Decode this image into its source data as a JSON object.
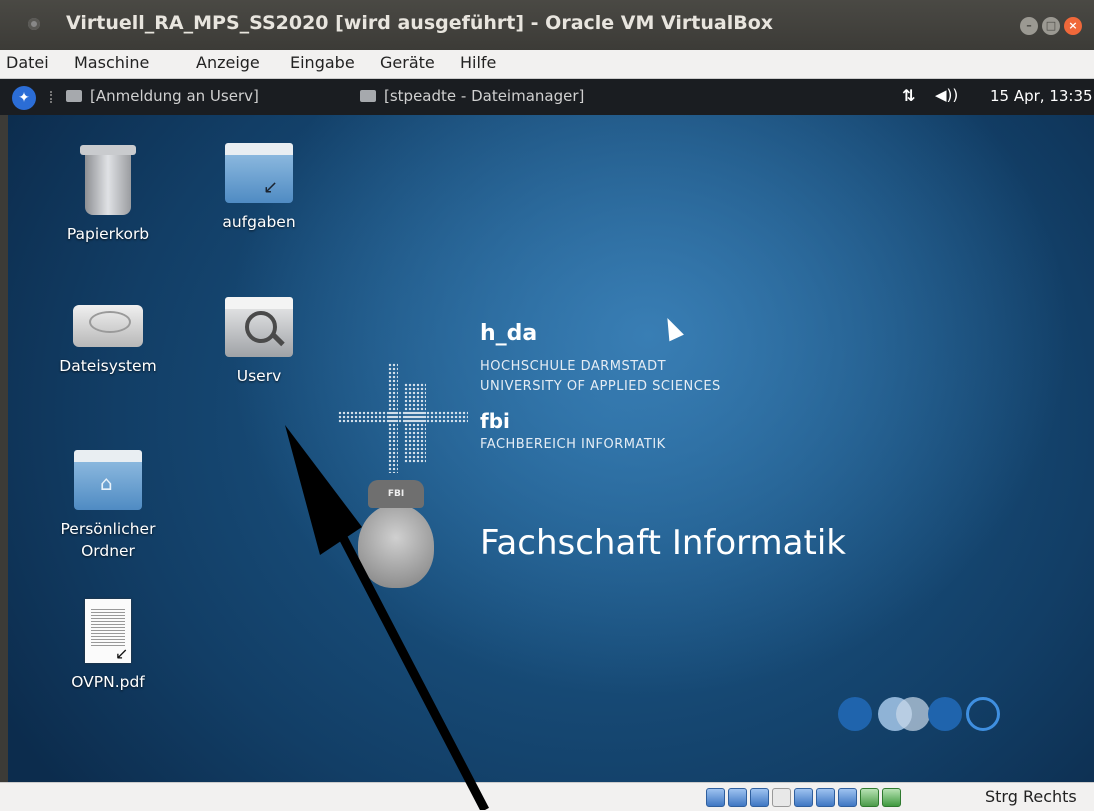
{
  "window": {
    "title": "Virtuell_RA_MPS_SS2020 [wird ausgeführt] - Oracle VM VirtualBox",
    "buttons": [
      "minimize-icon",
      "maximize-icon",
      "close-icon"
    ]
  },
  "menubar": {
    "items": [
      "Datei",
      "Maschine",
      "Anzeige",
      "Eingabe",
      "Geräte",
      "Hilfe"
    ]
  },
  "guest_panel": {
    "tasks": [
      "[Anmeldung an Userv]",
      "[stpeadte - Dateimanager]"
    ],
    "clock": "15 Apr, 13:35"
  },
  "desktop": {
    "icons": {
      "trash": "Papierkorb",
      "aufgaben": "aufgaben",
      "filesystem": "Dateisystem",
      "userv": "Userv",
      "home_line1": "Persönlicher",
      "home_line2": "Ordner",
      "pdf": "OVPN.pdf"
    },
    "wallpaper": {
      "h_da": "h_da",
      "hochschule": "HOCHSCHULE DARMSTADT",
      "university": "UNIVERSITY OF APPLIED SCIENCES",
      "fbi": "fbi",
      "fachbereich": "FACHBEREICH INFORMATIK",
      "mascot_cap": "FBI",
      "fachschaft": "Fachschaft Informatik"
    }
  },
  "statusbar": {
    "host_key": "Strg Rechts"
  },
  "colors": {
    "accent_close": "#f0683a",
    "desktop_blue": "#1f5f91"
  }
}
